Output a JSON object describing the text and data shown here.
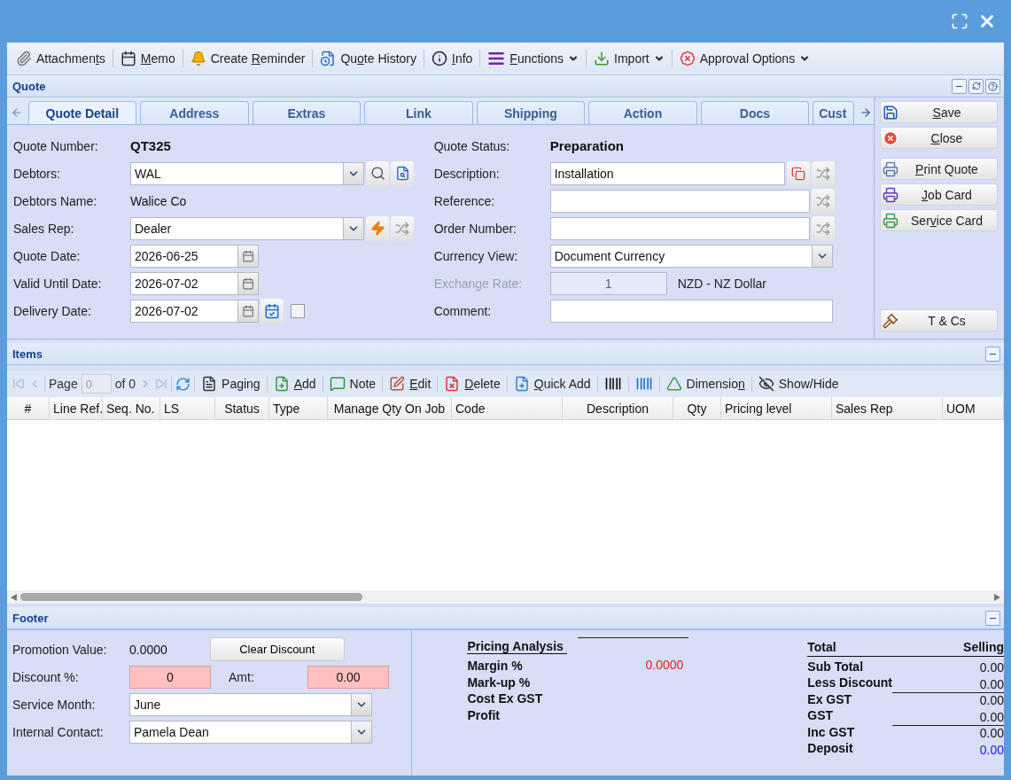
{
  "toolbar": [
    {
      "label": {
        "pre": "Attachmen",
        "key": "t",
        "post": "s"
      },
      "kind": "attach",
      "menu": false
    },
    {
      "label": {
        "key": "M",
        "post": "emo"
      },
      "kind": "memo",
      "menu": false
    },
    {
      "label": {
        "pre": "Create ",
        "key": "R",
        "post": "eminder"
      },
      "kind": "bell",
      "menu": false
    },
    {
      "label": {
        "pre": "Qu",
        "key": "o",
        "post": "te History"
      },
      "kind": "history",
      "menu": false
    },
    {
      "label": {
        "key": "I",
        "post": "nfo"
      },
      "kind": "info",
      "menu": false
    },
    {
      "label": {
        "key": "F",
        "post": "unctions"
      },
      "kind": "functions",
      "menu": true
    },
    {
      "label": {
        "pre": "Import"
      },
      "kind": "import",
      "menu": true
    },
    {
      "label": {
        "pre": "Approval Options"
      },
      "kind": "approval",
      "menu": true
    }
  ],
  "quote": {
    "title": "Quote",
    "tabs": [
      {
        "label": "Quote Detail",
        "selected": true
      },
      {
        "label": "Address",
        "selected": false
      },
      {
        "label": "Extras",
        "selected": false
      },
      {
        "label": "Link",
        "selected": false
      },
      {
        "label": "Shipping",
        "selected": false
      },
      {
        "label": "Action",
        "selected": false
      },
      {
        "label": "Docs",
        "selected": false
      },
      {
        "label": "Cust",
        "selected": false
      }
    ],
    "left_fields": [
      {
        "kind": "bold",
        "label": "Quote Number:",
        "value": "QT325"
      },
      {
        "kind": "lookup",
        "label": "Debtors:",
        "value": "WAL"
      },
      {
        "kind": "static",
        "label": "Debtors Name:",
        "value": "Walice Co"
      },
      {
        "kind": "rep",
        "label": "Sales Rep:",
        "value": "Dealer"
      },
      {
        "kind": "date",
        "label": "Quote Date:",
        "value": "2026-06-25"
      },
      {
        "kind": "date",
        "label": "Valid Until Date:",
        "value": "2026-07-02"
      },
      {
        "kind": "delivery",
        "label": "Delivery Date:",
        "value": "2026-07-02",
        "checked": false
      }
    ],
    "right_fields": [
      {
        "kind": "bold",
        "label": "Quote Status:",
        "value": "Preparation"
      },
      {
        "kind": "copy",
        "label": "Description:",
        "value": "Installation"
      },
      {
        "kind": "shuffle",
        "label": "Reference:"
      },
      {
        "kind": "shuffle",
        "label": "Order Number:"
      },
      {
        "kind": "select",
        "label": "Currency View:",
        "value": "Document Currency"
      },
      {
        "kind": "rate",
        "label": "Exchange Rate:",
        "value": "1",
        "disabled": true,
        "suffix": "NZD - NZ Dollar"
      },
      {
        "kind": "text",
        "label": "Comment:"
      }
    ],
    "side_buttons": [
      {
        "label": {
          "key": "S",
          "post": "ave"
        },
        "kind": "save"
      },
      {
        "label": {
          "key": "C",
          "post": "lose"
        },
        "kind": "close"
      },
      {
        "label": {
          "key": "P",
          "post": "rint Quote"
        },
        "kind": "print"
      },
      {
        "label": {
          "key": "J",
          "post": "ob Card"
        },
        "kind": "job"
      },
      {
        "label": {
          "pre": "Ser",
          "key": "v",
          "post": "ice Card"
        },
        "kind": "service"
      },
      {
        "label": {
          "pre": "T & Cs"
        },
        "kind": "terms"
      }
    ]
  },
  "items": {
    "title": "Items",
    "page_label": "Page",
    "page_value": "0",
    "of_label": "of 0",
    "tools": [
      {
        "kind": "paging",
        "label": {
          "pre": "Paging"
        }
      },
      {
        "kind": "add",
        "label": {
          "key": "A",
          "post": "dd"
        }
      },
      {
        "kind": "note",
        "label": {
          "pre": "Note"
        }
      },
      {
        "kind": "edit",
        "label": {
          "key": "E",
          "post": "dit"
        }
      },
      {
        "kind": "delete",
        "label": {
          "key": "D",
          "post": "elete"
        }
      },
      {
        "kind": "quickadd",
        "label": {
          "key": "Q",
          "post": "uick Add"
        }
      },
      {
        "kind": "barcode"
      },
      {
        "kind": "barcode2"
      },
      {
        "kind": "dimension",
        "label": {
          "pre": "Dimensio",
          "key": "n"
        }
      },
      {
        "kind": "showhide",
        "label": {
          "pre": "Show/Hide"
        }
      }
    ],
    "columns": [
      "#",
      "Line Ref.",
      "Seq. No.",
      "LS",
      "Status",
      "Type",
      "Manage Qty On Job",
      "Code",
      "Description",
      "Qty",
      "Pricing level",
      "Sales Rep",
      "UOM"
    ]
  },
  "footer": {
    "title": "Footer",
    "promotion_label": "Promotion Value:",
    "promotion_value": "0.0000",
    "clear_button": "Clear Discount",
    "discount_label": "Discount %:",
    "discount_value": "0",
    "amt_label": "Amt:",
    "amt_value": "0.00",
    "service_label": "Service Month:",
    "service_value": "June",
    "contact_label": "Internal Contact:",
    "contact_value": "Pamela Dean",
    "pricing_title": "Pricing Analysis",
    "pricing_rows": [
      {
        "label": "Margin %",
        "value": "0.0000"
      },
      {
        "label": "Mark-up %"
      },
      {
        "label": "Cost Ex GST"
      },
      {
        "label": "Profit"
      }
    ],
    "total_title": "Total",
    "selling_title": "Selling",
    "totals": [
      {
        "label": "Sub Total",
        "value": "0.00",
        "ruled": false,
        "kind": "plain"
      },
      {
        "label": "Less Discount",
        "value": "0.00",
        "ruled": false,
        "kind": "plain"
      },
      {
        "label": "Ex GST",
        "value": "0.00",
        "ruled": true,
        "kind": "plain"
      },
      {
        "label": "GST",
        "value": "0.00",
        "ruled": false,
        "kind": "plain"
      },
      {
        "label": "Inc GST",
        "value": "0.00",
        "ruled": true,
        "kind": "plain"
      },
      {
        "label": "Deposit",
        "value": "0.00",
        "ruled": false,
        "kind": "deposit"
      }
    ]
  }
}
